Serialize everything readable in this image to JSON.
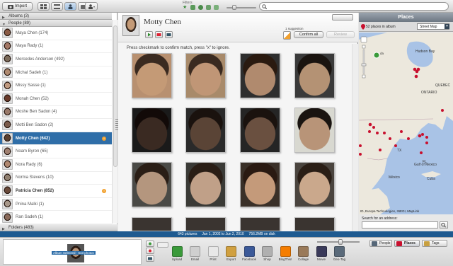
{
  "toolbar": {
    "import_label": "Import",
    "filters_label": "Filters",
    "search_placeholder": ""
  },
  "left": {
    "albums": "Albums (3)",
    "people_header": "People (89)",
    "folders": "Folders (483)",
    "people": [
      {
        "name": "Maya Chen (174)",
        "c": "#8a5a44"
      },
      {
        "name": "Maya Rady (1)",
        "c": "#a47866"
      },
      {
        "name": "Mercedes Anderson (492)",
        "c": "#7a6a5a"
      },
      {
        "name": "Michal Sadeh (1)",
        "c": "#b08a70"
      },
      {
        "name": "Missy Sasse (1)",
        "c": "#c09a80"
      },
      {
        "name": "Monah Chen (52)",
        "c": "#6a3a2a"
      },
      {
        "name": "Moshe Ben Sadon (4)",
        "c": "#9a7a6a"
      },
      {
        "name": "Motti Ben Sadon (2)",
        "c": "#7a5a4a"
      },
      {
        "name": "Motty Chen (642)",
        "c": "#5a4030",
        "selected": true,
        "warn": true
      },
      {
        "name": "Noam Byron (65)",
        "c": "#a08070"
      },
      {
        "name": "Nora Rady (6)",
        "c": "#b08870"
      },
      {
        "name": "Norma Stevens (10)",
        "c": "#908070"
      },
      {
        "name": "Patricia Chen (852)",
        "c": "#6a4a3a",
        "bold": true,
        "warn": true
      },
      {
        "name": "Pnina Malki (1)",
        "c": "#a8988a"
      },
      {
        "name": "Ran Sadeh (1)",
        "c": "#8a6a5a"
      }
    ]
  },
  "center": {
    "person_name": "Motty Chen",
    "suggestion": "1 suggestion",
    "confirm_all": "Confirm all",
    "review": "Review",
    "instructions": "Press checkmark to confirm match, press \"x\" to ignore.",
    "faces": [
      {
        "bg": "#b89070",
        "skin": "#c49a76",
        "hair": "#3a2a20"
      },
      {
        "bg": "#a88a6a",
        "skin": "#c09676",
        "hair": "#3a2a20"
      },
      {
        "bg": "#2e2e2e",
        "skin": "#b08a6e",
        "hair": "#2a1a10"
      },
      {
        "bg": "#3a3a3a",
        "skin": "#b49274",
        "hair": "#1a1410"
      },
      {
        "bg": "#1a1a1a",
        "skin": "#3a2a22",
        "hair": "#120a08"
      },
      {
        "bg": "#2a2a2a",
        "skin": "#5a4436",
        "hair": "#1a120e"
      },
      {
        "bg": "#252525",
        "skin": "#6a5040",
        "hair": "#1a120e"
      },
      {
        "bg": "#d8d8d0",
        "skin": "#b89478",
        "hair": "#1a1410"
      },
      {
        "bg": "#4a4a46",
        "skin": "#b4967e",
        "hair": "#2a1e16"
      },
      {
        "bg": "#3a3a36",
        "skin": "#c0a088",
        "hair": "#2a1e16"
      },
      {
        "bg": "#3a3028",
        "skin": "#c49a7a",
        "hair": "#2a1a12"
      },
      {
        "bg": "#4a443e",
        "skin": "#caa88c",
        "hair": "#2a1e16"
      }
    ]
  },
  "places": {
    "title": "Places",
    "count": "52 places in album",
    "map_type": "Street Map",
    "attribution": "ID, Europa Technologies, INEGI, MapLink",
    "addr_label": "Search for an address:",
    "map_labels": [
      {
        "t": "Hudson Bay"
      },
      {
        "t": "QUEBEC"
      },
      {
        "t": "ONTARIO"
      },
      {
        "t": "TX"
      },
      {
        "t": "FL"
      },
      {
        "t": "México"
      },
      {
        "t": "Gulf of Mexico"
      },
      {
        "t": "Cuba"
      }
    ]
  },
  "status": "643 pictures     Jan 1, 2002 to Jun 2, 2010     756.2MB on disk",
  "bottom": {
    "tray_label": "Album Selected - 643 photos",
    "actions": [
      {
        "label": "Upload",
        "c": "#3a9a3a"
      },
      {
        "label": "Email",
        "c": "#cfcfcf"
      },
      {
        "label": "Print",
        "c": "#e8e8e8"
      },
      {
        "label": "Export",
        "c": "#d0a040"
      },
      {
        "label": "Facebook",
        "c": "#3b5998"
      },
      {
        "label": "Shop",
        "c": "#b0b0b0"
      },
      {
        "label": "BlogThis!",
        "c": "#f57d00"
      },
      {
        "label": "Collage",
        "c": "#9a7a5a"
      },
      {
        "label": "Movie",
        "c": "#3a3a5a"
      },
      {
        "label": "Geo-Tag",
        "c": "#5a6a7a"
      }
    ],
    "tabs": {
      "people": "People",
      "places": "Places",
      "tags": "Tags"
    }
  }
}
